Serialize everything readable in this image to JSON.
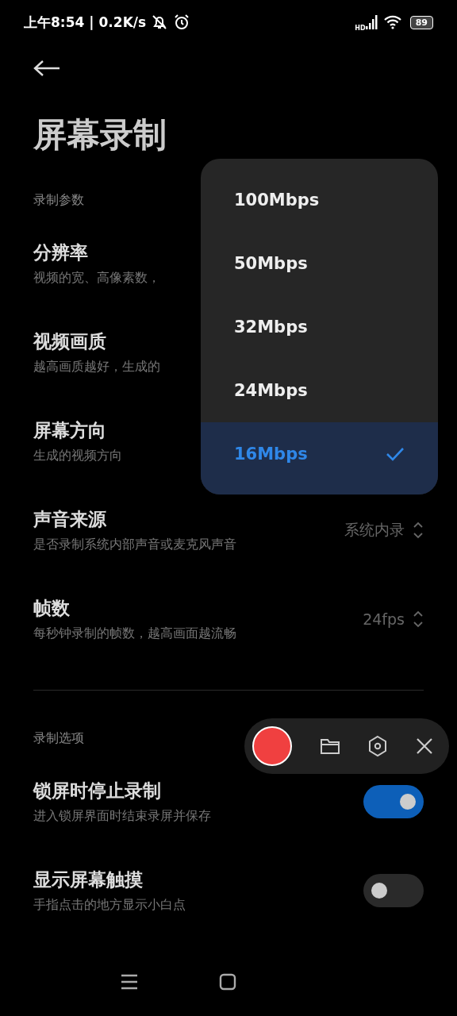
{
  "status_bar": {
    "time": "上午8:54",
    "separator": "|",
    "speed": "0.2K/s",
    "network_label": "HD",
    "battery": "89"
  },
  "title": "屏幕录制",
  "sections": [
    {
      "label": "录制参数",
      "rows": [
        {
          "kind": "picker",
          "title": "分辨率",
          "description": "视频的宽、高像素数，"
        },
        {
          "kind": "picker",
          "title": "视频画质",
          "description": "越高画质越好，生成的"
        },
        {
          "kind": "picker",
          "title": "屏幕方向",
          "description": "生成的视频方向"
        },
        {
          "kind": "picker",
          "title": "声音来源",
          "description": "是否录制系统内部声音或麦克风声音",
          "value": "系统内录"
        },
        {
          "kind": "picker",
          "title": "帧数",
          "description": "每秒钟录制的帧数，越高画面越流畅",
          "value": "24fps"
        }
      ]
    },
    {
      "label": "录制选项",
      "rows": [
        {
          "kind": "toggle",
          "title": "锁屏时停止录制",
          "description": "进入锁屏界面时结束录屏并保存",
          "on": true
        },
        {
          "kind": "toggle",
          "title": "显示屏幕触摸",
          "description": "手指点击的地方显示小白点",
          "on": false
        }
      ]
    }
  ],
  "dropdown": {
    "options": [
      {
        "label": "100Mbps",
        "selected": false
      },
      {
        "label": "50Mbps",
        "selected": false
      },
      {
        "label": "32Mbps",
        "selected": false
      },
      {
        "label": "24Mbps",
        "selected": false
      },
      {
        "label": "16Mbps",
        "selected": true
      }
    ]
  }
}
